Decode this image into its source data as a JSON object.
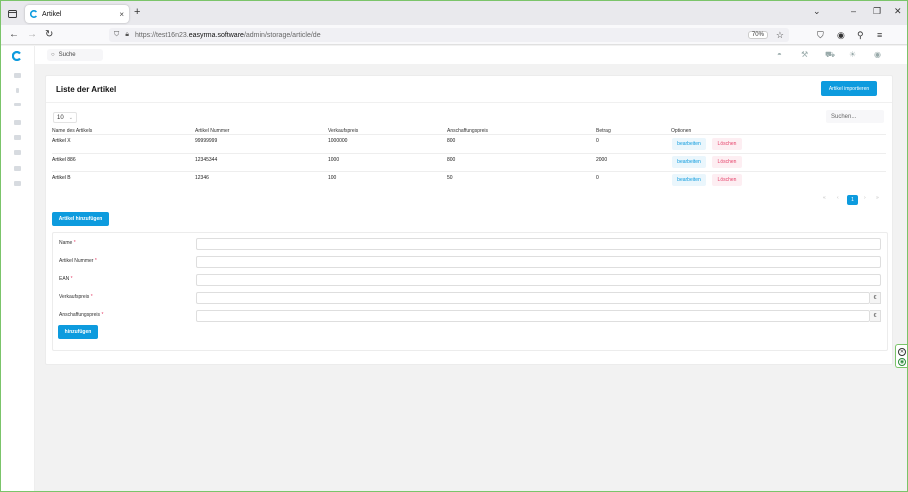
{
  "browser": {
    "tab_title": "Artikel",
    "tab_close": "×",
    "new_tab": "+",
    "url_prefix": "https://test16n23.",
    "url_domain": "easyrma.software",
    "url_path": "/admin/storage/article/de",
    "zoom": "70%",
    "window_controls": [
      "⌄",
      "–",
      "❐",
      "✕"
    ]
  },
  "app": {
    "search_placeholder": "Suche",
    "accent_color": "#0d9bde",
    "danger_color": "#e5416a"
  },
  "page": {
    "title": "Liste der Artikel",
    "import_button": "Artikel importieren",
    "per_page": "10",
    "table_search_placeholder": "Suchen...",
    "columns": [
      "Name des Artikels",
      "Artikel Nummer",
      "Verkaufspreis",
      "Anschaffungspreis",
      "Betrag",
      "Optionen"
    ],
    "rows": [
      {
        "name": "Artikel X",
        "number": "99999999",
        "sale": "1000000",
        "purchase": "800",
        "amount": "0",
        "edit": "bearbeiten",
        "delete": "Löschen"
      },
      {
        "name": "Artikel 886",
        "number": "12345344",
        "sale": "1000",
        "purchase": "800",
        "amount": "2000",
        "edit": "bearbeiten",
        "delete": "Löschen"
      },
      {
        "name": "Artikel B",
        "number": "12346",
        "sale": "100",
        "purchase": "50",
        "amount": "0",
        "edit": "bearbeiten",
        "delete": "Löschen"
      }
    ],
    "pagination": {
      "first": "«",
      "prev": "‹",
      "current": "1",
      "next": "›",
      "last": "»"
    },
    "add_article_button": "Artikel hinzufügen"
  },
  "form": {
    "fields": [
      {
        "label": "Name",
        "required": "*"
      },
      {
        "label": "Artikel Nummer",
        "required": "*"
      },
      {
        "label": "EAN",
        "required": "*"
      },
      {
        "label": "Verkaufspreis",
        "required": "*",
        "addon": "€"
      },
      {
        "label": "Anschaffungspreis",
        "required": "*",
        "addon": "€"
      }
    ],
    "submit_button": "hinzufügen"
  }
}
